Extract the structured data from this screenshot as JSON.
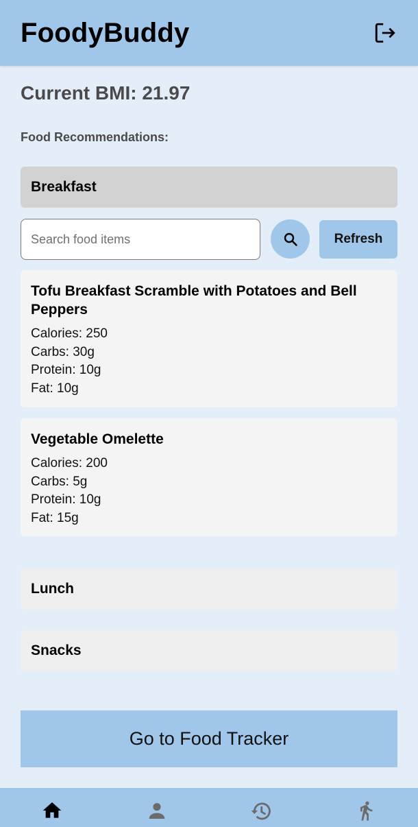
{
  "header": {
    "title": "FoodyBuddy",
    "logout_icon": "logout-icon"
  },
  "bmi": {
    "text": "Current BMI: 21.97",
    "value": 21.97
  },
  "recommendations_label": "Food Recommendations:",
  "sections": {
    "breakfast": "Breakfast",
    "lunch": "Lunch",
    "snacks": "Snacks"
  },
  "search": {
    "placeholder": "Search food items",
    "value": "",
    "icon": "search-icon"
  },
  "refresh_label": "Refresh",
  "foods": [
    {
      "name": "Tofu Breakfast Scramble with Potatoes and Bell Peppers",
      "calories": "Calories: 250",
      "carbs": "Carbs: 30g",
      "protein": "Protein: 10g",
      "fat": "Fat: 10g"
    },
    {
      "name": "Vegetable Omelette",
      "calories": "Calories: 200",
      "carbs": "Carbs: 5g",
      "protein": "Protein: 10g",
      "fat": "Fat: 15g"
    }
  ],
  "tracker_button": "Go to Food Tracker",
  "bottom_nav": [
    {
      "icon": "home-icon",
      "active": true
    },
    {
      "icon": "person-icon",
      "active": false
    },
    {
      "icon": "history-icon",
      "active": false
    },
    {
      "icon": "walk-icon",
      "active": false
    }
  ],
  "colors": {
    "primary": "#a0c6ea",
    "background": "#e3eef9",
    "active_section": "#d2d2d2",
    "inactive_section": "#efefef",
    "card": "#f4f4f4",
    "nav_active": "#000000",
    "nav_inactive": "#6b6b6b"
  }
}
